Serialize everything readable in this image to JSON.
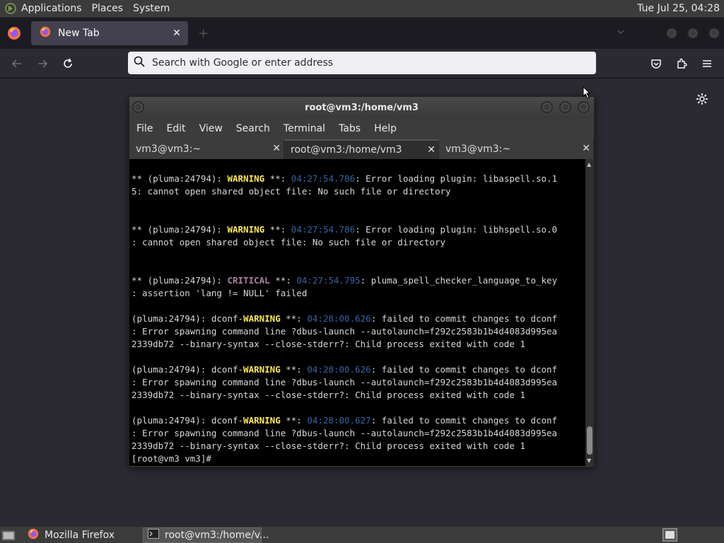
{
  "top_panel": {
    "menus": [
      "Applications",
      "Places",
      "System"
    ],
    "clock": "Tue Jul 25, 04:28"
  },
  "firefox": {
    "tab_title": "New Tab",
    "new_tab_symbol": "+",
    "url_placeholder": "Search with Google or enter address"
  },
  "terminal": {
    "title": "root@vm3:/home/vm3",
    "menu": [
      "File",
      "Edit",
      "View",
      "Search",
      "Terminal",
      "Tabs",
      "Help"
    ],
    "tabs": [
      {
        "label": "vm3@vm3:~",
        "active": false
      },
      {
        "label": "root@vm3:/home/vm3",
        "active": true
      },
      {
        "label": "vm3@vm3:~",
        "active": false
      }
    ],
    "lines": [
      [
        {
          "t": "** (pluma:24794): "
        },
        {
          "t": "WARNING",
          "c": "warn"
        },
        {
          "t": " **: "
        },
        {
          "t": "04:27:54.786",
          "c": "ts"
        },
        {
          "t": ": Error loading plugin: libaspell.so.1"
        }
      ],
      [
        {
          "t": "5: cannot open shared object file: No such file or directory"
        }
      ],
      [],
      [],
      [
        {
          "t": "** (pluma:24794): "
        },
        {
          "t": "WARNING",
          "c": "warn"
        },
        {
          "t": " **: "
        },
        {
          "t": "04:27:54.786",
          "c": "ts"
        },
        {
          "t": ": Error loading plugin: libhspell.so.0"
        }
      ],
      [
        {
          "t": ": cannot open shared object file: No such file or directory"
        }
      ],
      [],
      [],
      [
        {
          "t": "** (pluma:24794): "
        },
        {
          "t": "CRITICAL",
          "c": "crit"
        },
        {
          "t": " **: "
        },
        {
          "t": "04:27:54.795",
          "c": "ts"
        },
        {
          "t": ": pluma_spell_checker_language_to_key"
        }
      ],
      [
        {
          "t": ": assertion 'lang != NULL' failed"
        }
      ],
      [],
      [
        {
          "t": "(pluma:24794): dconf-"
        },
        {
          "t": "WARNING",
          "c": "warn"
        },
        {
          "t": " **: "
        },
        {
          "t": "04:28:00.626",
          "c": "ts"
        },
        {
          "t": ": failed to commit changes to dconf"
        }
      ],
      [
        {
          "t": ": Error spawning command line ?dbus-launch --autolaunch=f292c2583b1b4d4083d995ea"
        }
      ],
      [
        {
          "t": "2339db72 --binary-syntax --close-stderr?: Child process exited with code 1"
        }
      ],
      [],
      [
        {
          "t": "(pluma:24794): dconf-"
        },
        {
          "t": "WARNING",
          "c": "warn"
        },
        {
          "t": " **: "
        },
        {
          "t": "04:28:00.626",
          "c": "ts"
        },
        {
          "t": ": failed to commit changes to dconf"
        }
      ],
      [
        {
          "t": ": Error spawning command line ?dbus-launch --autolaunch=f292c2583b1b4d4083d995ea"
        }
      ],
      [
        {
          "t": "2339db72 --binary-syntax --close-stderr?: Child process exited with code 1"
        }
      ],
      [],
      [
        {
          "t": "(pluma:24794): dconf-"
        },
        {
          "t": "WARNING",
          "c": "warn"
        },
        {
          "t": " **: "
        },
        {
          "t": "04:28:00.627",
          "c": "ts"
        },
        {
          "t": ": failed to commit changes to dconf"
        }
      ],
      [
        {
          "t": ": Error spawning command line ?dbus-launch --autolaunch=f292c2583b1b4d4083d995ea"
        }
      ],
      [
        {
          "t": "2339db72 --binary-syntax --close-stderr?: Child process exited with code 1"
        }
      ],
      [
        {
          "t": "[root@vm3 vm3]# "
        }
      ]
    ]
  },
  "taskbar": {
    "tasks": [
      {
        "label": "Mozilla Firefox",
        "icon": "firefox-icon",
        "active": false
      },
      {
        "label": "root@vm3:/home/v...",
        "icon": "terminal-icon",
        "active": true
      }
    ]
  },
  "colors": {
    "warning": "#fce94f",
    "critical": "#ad7fa8",
    "timestamp": "#3465a4"
  }
}
